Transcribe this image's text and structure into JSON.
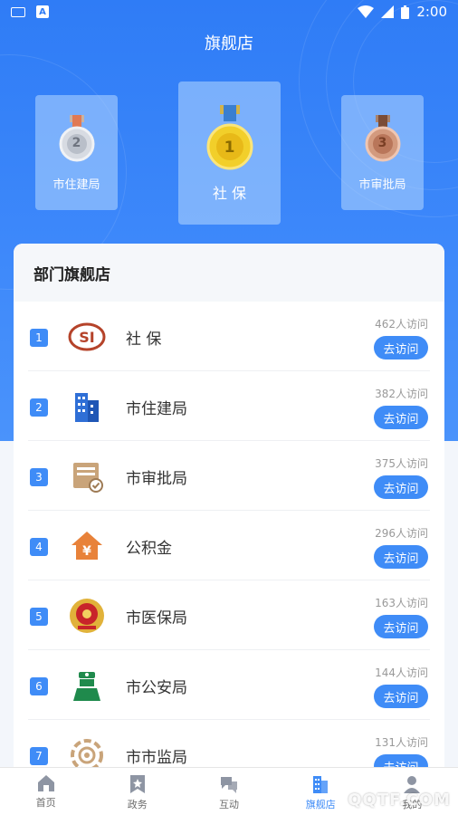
{
  "status_bar": {
    "a_badge": "A",
    "time": "2:00"
  },
  "header": {
    "title": "旗舰店"
  },
  "podium": [
    {
      "rank": "2",
      "label": "市住建局"
    },
    {
      "rank": "1",
      "label": "社 保"
    },
    {
      "rank": "3",
      "label": "市审批局"
    }
  ],
  "panel": {
    "title": "部门旗舰店",
    "button_label": "去访问",
    "rows": [
      {
        "rank": "1",
        "name": "社 保",
        "visits": "462人访问",
        "icon": "si-logo-icon"
      },
      {
        "rank": "2",
        "name": "市住建局",
        "visits": "382人访问",
        "icon": "building-icon"
      },
      {
        "rank": "3",
        "name": "市审批局",
        "visits": "375人访问",
        "icon": "approval-icon"
      },
      {
        "rank": "4",
        "name": "公积金",
        "visits": "296人访问",
        "icon": "housing-fund-icon"
      },
      {
        "rank": "5",
        "name": "市医保局",
        "visits": "163人访问",
        "icon": "emblem-icon"
      },
      {
        "rank": "6",
        "name": "市公安局",
        "visits": "144人访问",
        "icon": "police-icon"
      },
      {
        "rank": "7",
        "name": "市市监局",
        "visits": "131人访问",
        "icon": "market-supervision-icon"
      }
    ]
  },
  "tabbar": [
    {
      "label": "首页",
      "icon": "home-icon"
    },
    {
      "label": "政务",
      "icon": "bookmark-icon"
    },
    {
      "label": "互动",
      "icon": "chat-icon"
    },
    {
      "label": "旗舰店",
      "icon": "building-icon",
      "active": true
    },
    {
      "label": "我的",
      "icon": "user-icon"
    }
  ],
  "watermark": "QQTF.COM",
  "colors": {
    "primary": "#3f8cf7",
    "hero": "#2f7cf6"
  }
}
